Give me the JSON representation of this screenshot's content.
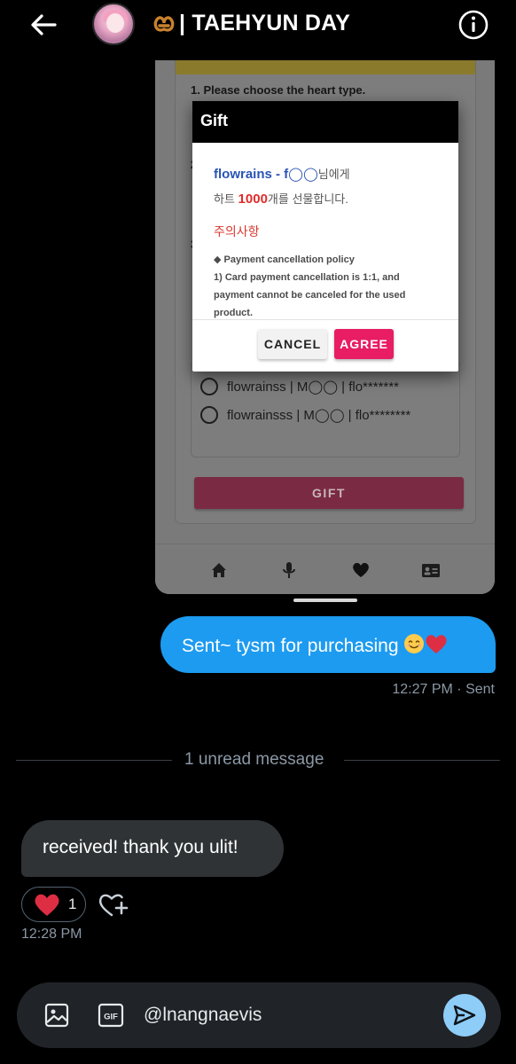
{
  "header": {
    "title": "| TAEHYUN DAY",
    "title_emoji": "pretzel",
    "avatar_alt": "user-avatar"
  },
  "shared_image": {
    "question": "1. Please choose the heart type.",
    "options": [
      "flowrainss | M◯◯ | flo*******",
      "flowrainsss | M◯◯ | flo********"
    ],
    "gift_button": "GIFT",
    "nav_icons": [
      "home-icon",
      "microphone-icon",
      "heart-icon",
      "id-card-icon"
    ],
    "dialog": {
      "title": "Gift",
      "recipient": "flowrains - f◯◯",
      "recipient_suffix": "님에게",
      "line2_prefix": "하트 ",
      "amount": "1000",
      "line2_suffix": "개를 선물합니다.",
      "notice_title": "주의사항",
      "policy_line1": "◆ Payment cancellation policy",
      "policy_line2": "1) Card payment cancellation is 1:1, and",
      "policy_line3": "payment cannot be canceled for the used",
      "policy_line4": "product.",
      "cancel_label": "CANCEL",
      "agree_label": "AGREE"
    }
  },
  "messages": {
    "sent_text": "Sent~ tysm for purchasing ",
    "sent_emojis": "smiling-face, red-heart",
    "sent_meta": "12:27 PM · Sent",
    "unread_label": "1 unread message",
    "received_text": "received! thank you ulit!",
    "reaction_count": "1",
    "reaction_emoji": "red-heart",
    "received_meta": "12:28 PM"
  },
  "composer": {
    "input_value": "@lnangnaevis",
    "gif_label": "GIF"
  },
  "colors": {
    "accent_blue": "#1d9bf0",
    "received_bubble": "#2f3336",
    "agree_pink": "#e81d63",
    "muted_text": "#8b98a5"
  }
}
